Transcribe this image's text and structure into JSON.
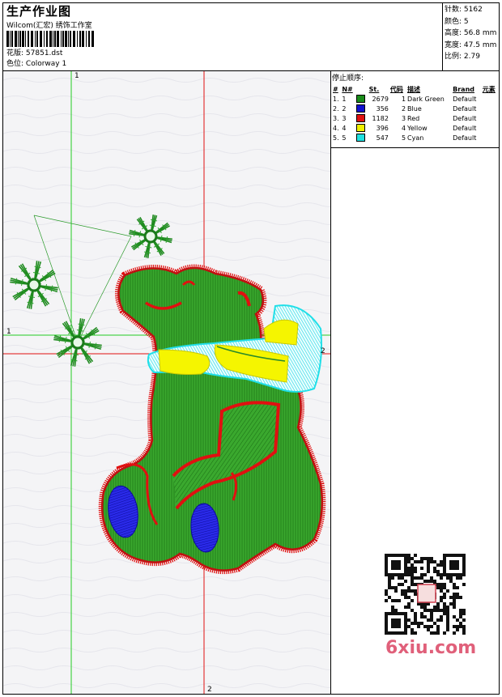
{
  "header": {
    "title": "生产作业图",
    "company": "Wilcom(汇宏) 绣饰工作室",
    "design_label": "花版:",
    "design_value": "57851.dst",
    "colorway_label": "色位:",
    "colorway_value": "Colorway 1"
  },
  "stats": {
    "stitches_label": "针数:",
    "stitches_value": "5162",
    "colors_label": "颜色:",
    "colors_value": "5",
    "height_label": "高度:",
    "height_value": "56.8 mm",
    "width_label": "宽度:",
    "width_value": "47.5 mm",
    "scale_label": "比例:",
    "scale_value": "2.79"
  },
  "stop_sequence": {
    "title": "停止顺序:",
    "headers": [
      "#",
      "N#",
      "St.",
      "代码",
      "描述",
      "Brand",
      "元素"
    ],
    "rows": [
      {
        "num": "1.",
        "n": "1",
        "color": "#1a8c1a",
        "st": "2679",
        "code": "1",
        "desc": "Dark Green",
        "brand": "Default"
      },
      {
        "num": "2.",
        "n": "2",
        "color": "#1010d0",
        "st": "356",
        "code": "2",
        "desc": "Blue",
        "brand": "Default"
      },
      {
        "num": "3.",
        "n": "3",
        "color": "#e01010",
        "st": "1182",
        "code": "3",
        "desc": "Red",
        "brand": "Default"
      },
      {
        "num": "4.",
        "n": "4",
        "color": "#f0f000",
        "st": "396",
        "code": "4",
        "desc": "Yellow",
        "brand": "Default"
      },
      {
        "num": "5.",
        "n": "5",
        "color": "#20e0e0",
        "st": "547",
        "code": "5",
        "desc": "Cyan",
        "brand": "Default"
      }
    ]
  },
  "guides": {
    "v1_label": "1",
    "h1_label": "1",
    "h2_label": "2",
    "v2_label": "2"
  },
  "watermark": {
    "text": "6xiu.com"
  },
  "colors": {
    "green": "#2e9e23",
    "dark_green": "#1a6e14",
    "red": "#e01010",
    "yellow": "#f5f500",
    "cyan": "#30e0e8",
    "blue": "#1414d8",
    "guide_green": "#22cc22",
    "guide_red": "#e01010"
  }
}
